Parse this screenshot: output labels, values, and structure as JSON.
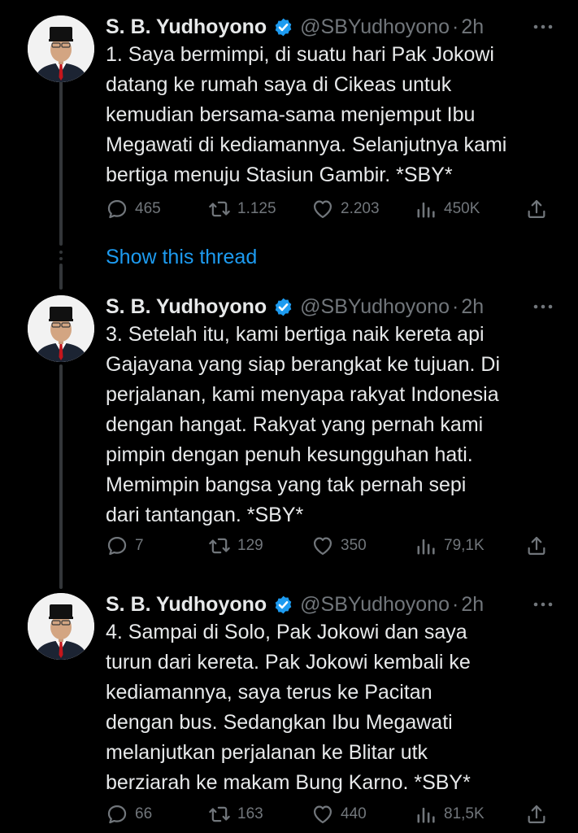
{
  "author": {
    "name": "S. B. Yudhoyono",
    "handle": "@SBYudhoyono",
    "separator": "·",
    "time": "2h"
  },
  "show_thread_label": "Show this thread",
  "tweets": [
    {
      "text": "1. Saya bermimpi, di suatu hari Pak Jokowi\ndatang ke rumah saya di Cikeas untuk\nkemudian bersama-sama menjemput Ibu\nMegawati di kediamannya. Selanjutnya kami\nbertiga menuju Stasiun Gambir. *SBY*",
      "replies": "465",
      "retweets": "1.125",
      "likes": "2.203",
      "views": "450K"
    },
    {
      "text": "3. Setelah itu, kami bertiga naik kereta api\nGajayana yang siap berangkat ke tujuan. Di\nperjalanan, kami menyapa rakyat Indonesia\ndengan hangat. Rakyat yang pernah kami\npimpin dengan penuh kesungguhan hati.\nMemimpin bangsa yang tak pernah sepi\ndari tantangan. *SBY*",
      "replies": "7",
      "retweets": "129",
      "likes": "350",
      "views": "79,1K"
    },
    {
      "text": "4. Sampai di Solo, Pak Jokowi dan saya\nturun dari kereta. Pak Jokowi kembali ke\nkediamannya, saya terus ke Pacitan\ndengan bus. Sedangkan Ibu Megawati\nmelanjutkan perjalanan ke Blitar utk\nberziarah ke makam Bung Karno. *SBY*",
      "replies": "66",
      "retweets": "163",
      "likes": "440",
      "views": "81,5K"
    }
  ],
  "colors": {
    "background": "#000000",
    "text": "#e7e9ea",
    "muted": "#71767b",
    "link": "#1d9bf0",
    "verified": "#1d9bf0",
    "thread_line": "#333639"
  },
  "icons": [
    "verified-badge-icon",
    "more-icon",
    "reply-icon",
    "retweet-icon",
    "like-icon",
    "views-icon",
    "share-icon"
  ]
}
